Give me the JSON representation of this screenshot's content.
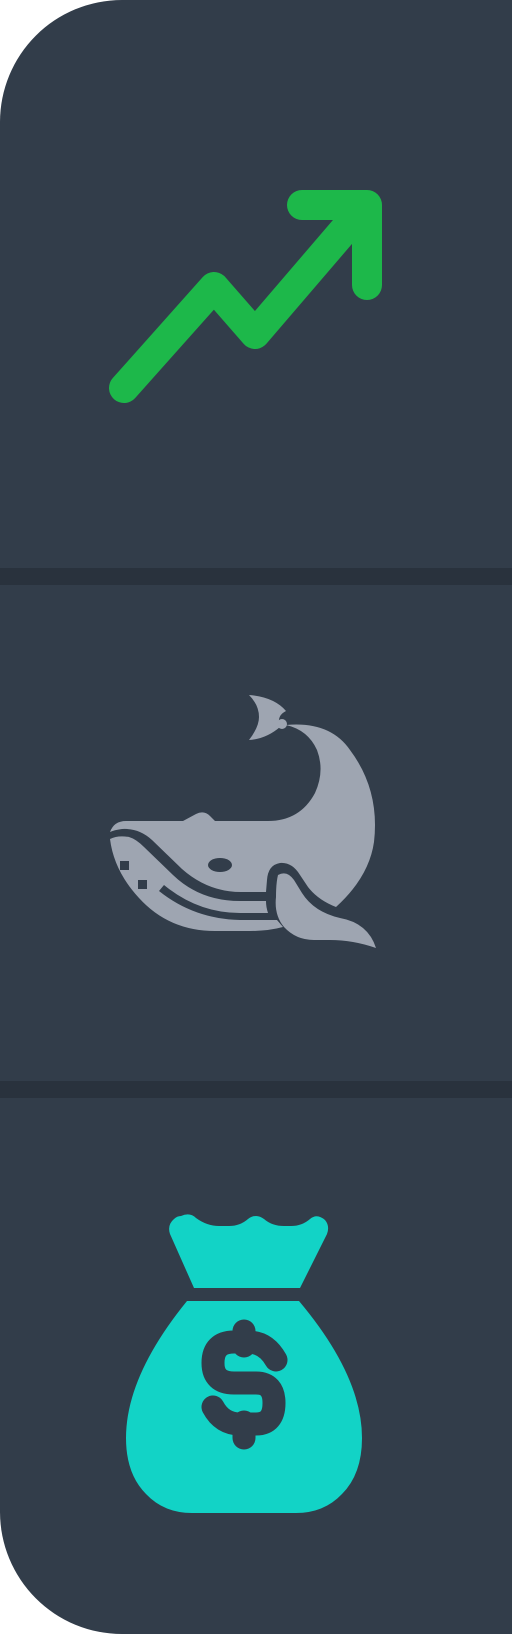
{
  "rail": {
    "background": "#323d4a",
    "divider_color": "#29323d"
  },
  "items": [
    {
      "icon": "trending-up-arrow-icon",
      "color": "#1db84a"
    },
    {
      "icon": "whale-icon",
      "color": "#9ea5b1"
    },
    {
      "icon": "money-bag-dollar-icon",
      "color": "#12d3c6"
    }
  ]
}
